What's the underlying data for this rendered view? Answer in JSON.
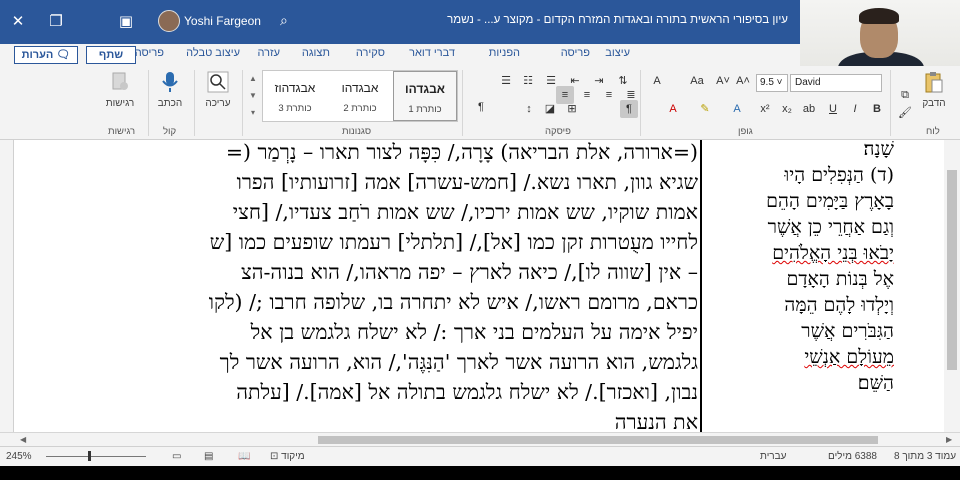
{
  "titlebar": {
    "close_icon": "close-icon",
    "user_name": "Yoshi Fargeon",
    "doc_title": "עיון בסיפורי הראשית בתורה ובאגדות המזרח הקדום - מקוצר ע... - נשמר"
  },
  "tabs": {
    "comments": "הערות",
    "share": "שתף",
    "items": [
      "עיצוב",
      "פריסה",
      "הפניות",
      "דברי דואר",
      "סקירה",
      "תצוגה",
      "עזרה",
      "עיצוב טבלה",
      "פריסה"
    ]
  },
  "ribbon": {
    "groups": {
      "clipboard": "לוח",
      "font": "גופן",
      "paragraph": "פיסקה",
      "styles": "סגנונות",
      "voice": "קול",
      "sensitivity": "רגישות"
    },
    "paste_label": "הדבק",
    "font_name": "David",
    "font_size": "9.5",
    "styles": [
      {
        "sample": "אבגדהו",
        "name": "כותרת 1"
      },
      {
        "sample": "אבגדהו",
        "name": "כותרת 2"
      },
      {
        "sample": "אבגדהוז",
        "name": "כותרת 3"
      }
    ],
    "editing_label": "עריכה",
    "dictate_label": "הכתב",
    "sensitivity_label": "רגישות"
  },
  "document": {
    "lines": [
      "(=ארורה, אלת הבריאה) צָרָה,/ כִּפָּה לצור תארו – נָרְמַר (=",
      "שגיא גוון, תארו נשא./ [חמש-עשרה] אמה [זרועותיו] הפרו",
      "אמות שוקיו, שש אמות ירכיו,/ שש אמות רֹחַב צעדיו,/ [חצי",
      "לחייו מעֻטרות זקן כמו [אל],/ [תלתלי] רעמתו שופעים כמו [ש",
      "– אין [שווה לו],/ כיאה לארץ – יפה מראהו,/ הוא בנוה-הצ",
      "כראם, מרומם ראשו,/ איש לא יתחרה בו, שלופה חרבו ;/ (לקו",
      "יפיל אימה על העלמים בני ארך :/ לא ישלח גלגמש בן אל",
      "גלגמש, הוא הרועה אשר לארך 'הַנִּגֶּה',/ הוא, הרועה אשר לך",
      "נבון, [ואכזר]./ לא ישלח גלגמש בתולה אל [אמה]./ [עלתה",
      "את הנערה"
    ],
    "side_lines": [
      "שָׁנָה׃",
      "(ד) הַנְּפִלִים הָיוּ",
      "בָאָרֶץ בַּיָּמִים הָהֵם",
      "וְגַם אַחֲרֵי כֵן אֲשֶׁר",
      "יָבֹאוּ בְּנֵי הָאֱלֹהִים",
      "אֶל בְּנוֹת הָאָדָם",
      "וְיָלְדוּ לָהֶם הֵמָּה",
      "הַגִּבֹּרִים אֲשֶׁר",
      "מֵעוֹלָם אַנְשֵׁי",
      "הַשֵּׁם׃"
    ]
  },
  "statusbar": {
    "page": "עמוד 3 מתוך 8",
    "words": "6388 מילים",
    "language": "עברית",
    "focus": "מיקוד",
    "zoom": "245%",
    "zoom_fraction": 0.42
  }
}
